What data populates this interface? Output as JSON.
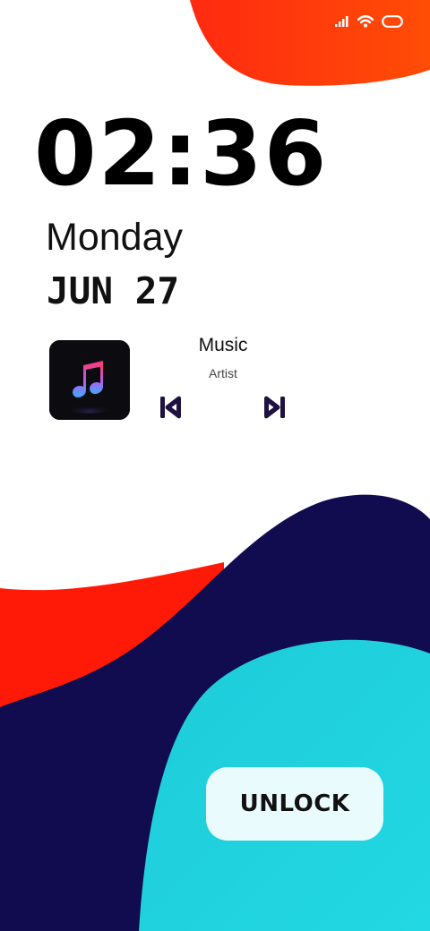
{
  "clock": {
    "time": "02:36",
    "day": "Monday",
    "date": "JUN 27"
  },
  "music": {
    "title": "Music",
    "artist": "Artist",
    "album_icon": "music-note-icon",
    "prev_icon": "skip-previous-icon",
    "next_icon": "skip-next-icon"
  },
  "status_bar": {
    "icons": [
      "signal-icon",
      "wifi-icon",
      "battery-icon"
    ]
  },
  "unlock": {
    "label": "UNLOCK"
  },
  "colors": {
    "orange": "#ff3d12",
    "red": "#ff1a08",
    "navy": "#110b4f",
    "cyan": "#1fd0dd",
    "button_bg": "#eafbfd",
    "text": "#111111",
    "control": "#1e1240"
  }
}
